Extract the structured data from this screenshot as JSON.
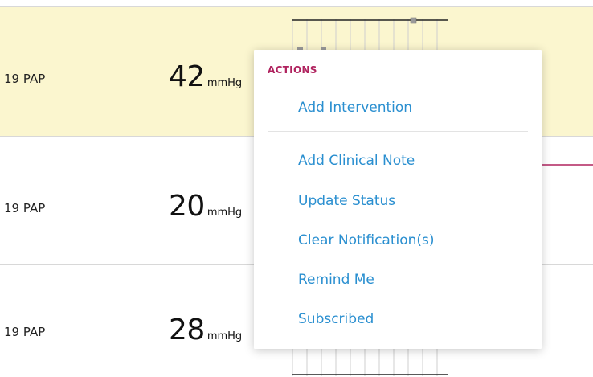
{
  "rows": [
    {
      "label": "19 PAP",
      "value": "42",
      "unit": "mmHg",
      "highlighted": true
    },
    {
      "label": "19 PAP",
      "value": "20",
      "unit": "mmHg",
      "highlighted": false
    },
    {
      "label": "19 PAP",
      "value": "28",
      "unit": "mmHg",
      "highlighted": false
    }
  ],
  "actions_menu": {
    "heading": "ACTIONS",
    "items": [
      {
        "label": "Add Intervention"
      },
      {
        "label": "Add Clinical Note"
      },
      {
        "label": "Update Status"
      },
      {
        "label": "Clear Notification(s)"
      },
      {
        "label": "Remind Me"
      },
      {
        "label": "Subscribed"
      }
    ]
  },
  "colors": {
    "highlight_row": "#fbf6cf",
    "menu_heading": "#b0235f",
    "menu_link": "#2a8fd0",
    "connector": "#b0235f"
  }
}
